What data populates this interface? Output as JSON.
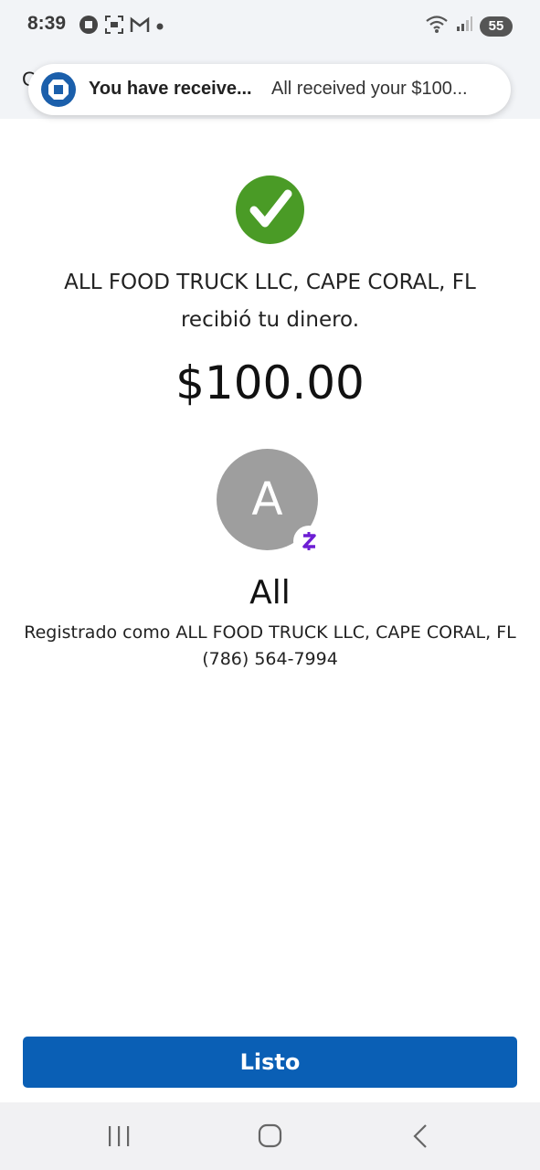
{
  "status_bar": {
    "time": "8:39",
    "left_icons": [
      "chase-icon",
      "screenshot-icon",
      "gmail-icon",
      "dot-icon"
    ],
    "right_icons": [
      "wifi-icon",
      "signal-icon"
    ],
    "battery": "55"
  },
  "header": {
    "peek_text": "C"
  },
  "notification": {
    "title": "You have receive...",
    "body": "All received your $100...",
    "icon": "chase-icon"
  },
  "confirmation": {
    "success_icon": "checkmark-icon",
    "recipient_line1": "ALL FOOD TRUCK LLC, CAPE CORAL, FL",
    "recipient_line2": "recibió tu dinero.",
    "amount": "$100.00"
  },
  "contact": {
    "avatar_initial": "A",
    "badge_icon": "zelle-icon",
    "name": "All",
    "registered_as": "Registrado como ALL FOOD TRUCK LLC, CAPE CORAL, FL",
    "phone": "(786) 564-7994"
  },
  "actions": {
    "done_label": "Listo"
  },
  "nav": {
    "buttons": [
      "recents-icon",
      "home-icon",
      "back-icon"
    ]
  },
  "colors": {
    "success_green": "#4a9b26",
    "primary_blue": "#0a5fb5",
    "chase_blue": "#1b5fab",
    "zelle_purple": "#6d1ed4",
    "avatar_gray": "#9e9e9e"
  }
}
